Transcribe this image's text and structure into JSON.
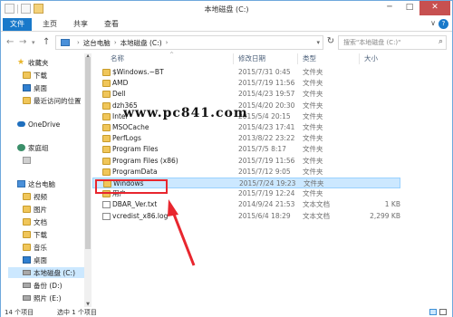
{
  "title": "本地磁盘 (C:)",
  "ribbon": {
    "file": "文件",
    "home": "主页",
    "share": "共享",
    "view": "查看",
    "chevron": "∨",
    "help": "?"
  },
  "window_controls": {
    "minimize": "─",
    "maximize": "□",
    "close": "✕"
  },
  "nav_buttons": {
    "back": "←",
    "forward": "→",
    "dropdown": "▾",
    "up": "↑"
  },
  "address": {
    "crumbs": [
      "这台电脑",
      "本地磁盘 (C:)"
    ],
    "separator": "›"
  },
  "search": {
    "placeholder": "搜索\"本地磁盘 (C:)\"",
    "icon": "⌕"
  },
  "refresh_icon": "↻",
  "sidebar": {
    "items": [
      {
        "label": "收藏夹",
        "icon": "star-icon"
      },
      {
        "label": "下载",
        "icon": "folder-icon"
      },
      {
        "label": "桌面",
        "icon": "folder-icon"
      },
      {
        "label": "最近访问的位置",
        "icon": "folder-icon"
      },
      {
        "label": "OneDrive",
        "icon": "cloud-icon"
      },
      {
        "label": "家庭组",
        "icon": "homegroup-icon"
      },
      {
        "label": "",
        "icon": "user-icon"
      },
      {
        "label": "这台电脑",
        "icon": "pc-icon"
      },
      {
        "label": "视频",
        "icon": "folder-icon"
      },
      {
        "label": "图片",
        "icon": "folder-icon"
      },
      {
        "label": "文档",
        "icon": "folder-icon"
      },
      {
        "label": "下载",
        "icon": "folder-icon"
      },
      {
        "label": "音乐",
        "icon": "folder-icon"
      },
      {
        "label": "桌面",
        "icon": "folder-icon"
      },
      {
        "label": "本地磁盘 (C:)",
        "icon": "drive-icon"
      },
      {
        "label": "备份 (D:)",
        "icon": "drive-icon"
      },
      {
        "label": "照片 (E:)",
        "icon": "drive-icon"
      }
    ]
  },
  "columns": {
    "name": "名称",
    "date": "修改日期",
    "type": "类型",
    "size": "大小",
    "sort_indicator": "^"
  },
  "files": [
    {
      "name": "$Windows.~BT",
      "date": "2015/7/31 0:45",
      "type": "文件夹",
      "size": "",
      "kind": "folder"
    },
    {
      "name": "AMD",
      "date": "2015/7/19 11:56",
      "type": "文件夹",
      "size": "",
      "kind": "folder"
    },
    {
      "name": "Dell",
      "date": "2015/4/23 19:57",
      "type": "文件夹",
      "size": "",
      "kind": "folder"
    },
    {
      "name": "dzh365",
      "date": "2015/4/20 20:30",
      "type": "文件夹",
      "size": "",
      "kind": "folder"
    },
    {
      "name": "Intel",
      "date": "2015/5/4 20:15",
      "type": "文件夹",
      "size": "",
      "kind": "folder"
    },
    {
      "name": "MSOCache",
      "date": "2015/4/23 17:41",
      "type": "文件夹",
      "size": "",
      "kind": "folder"
    },
    {
      "name": "PerfLogs",
      "date": "2013/8/22 23:22",
      "type": "文件夹",
      "size": "",
      "kind": "folder"
    },
    {
      "name": "Program Files",
      "date": "2015/7/5 8:17",
      "type": "文件夹",
      "size": "",
      "kind": "folder"
    },
    {
      "name": "Program Files (x86)",
      "date": "2015/7/19 11:56",
      "type": "文件夹",
      "size": "",
      "kind": "folder"
    },
    {
      "name": "ProgramData",
      "date": "2015/7/12 9:05",
      "type": "文件夹",
      "size": "",
      "kind": "folder"
    },
    {
      "name": "Windows",
      "date": "2015/7/24 19:23",
      "type": "文件夹",
      "size": "",
      "kind": "folder"
    },
    {
      "name": "用户",
      "date": "2015/7/19 12:24",
      "type": "文件夹",
      "size": "",
      "kind": "folder"
    },
    {
      "name": "DBAR_Ver.txt",
      "date": "2014/9/24 21:53",
      "type": "文本文档",
      "size": "1 KB",
      "kind": "file"
    },
    {
      "name": "vcredist_x86.log",
      "date": "2015/6/4 18:29",
      "type": "文本文档",
      "size": "2,299 KB",
      "kind": "file"
    }
  ],
  "selected_file": "Windows",
  "watermark": "www.pc841.com",
  "status": {
    "count": "14 个项目",
    "selected": "选中 1 个项目"
  },
  "colors": {
    "accent": "#1979ca",
    "selection": "#cce8ff",
    "annotation": "#e8262e",
    "folder": "#f0c65a"
  }
}
